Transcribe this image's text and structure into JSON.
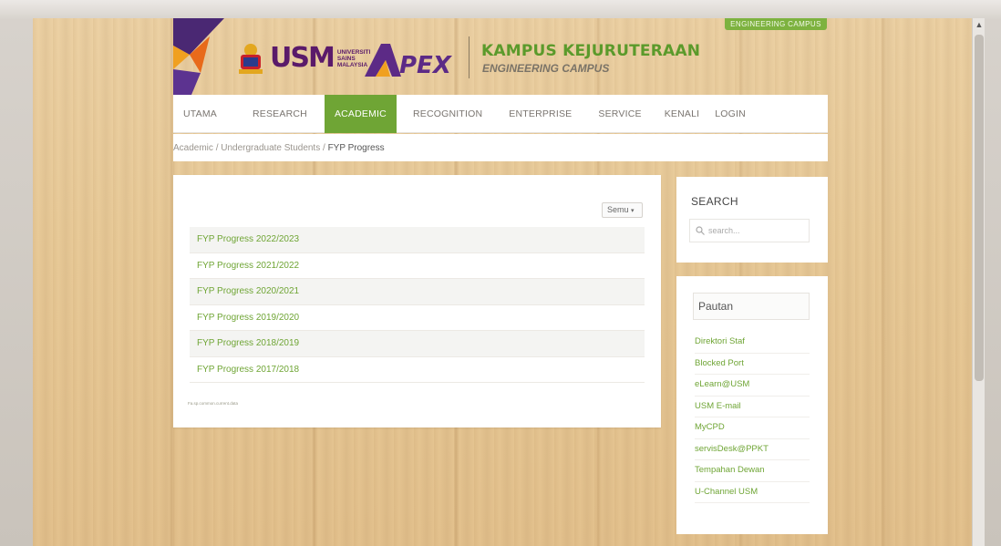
{
  "header": {
    "campus_badge": "ENGINEERING CAMPUS",
    "usm_mark": "USM",
    "usm_small": "UNIVERSITI SAINS MALAYSIA",
    "apex_mark": "APEX",
    "campus_title": "KAMPUS KEJURUTERAAN",
    "campus_subtitle": "ENGINEERING CAMPUS"
  },
  "nav": {
    "items": [
      {
        "label": "UTAMA"
      },
      {
        "label": "RESEARCH"
      },
      {
        "label": "ACADEMIC",
        "active": true
      },
      {
        "label": "RECOGNITION"
      },
      {
        "label": "ENTERPRISE"
      },
      {
        "label": "SERVICE"
      },
      {
        "label": "KENALI"
      },
      {
        "label": "LOGIN"
      }
    ]
  },
  "breadcrumb": {
    "items": [
      "Academic",
      "Undergraduate Students",
      "FYP Progress"
    ],
    "separator": "/"
  },
  "main": {
    "filter_value": "Semu",
    "list": [
      "FYP Progress 2022/2023",
      "FYP Progress 2021/2022",
      "FYP Progress 2020/2021",
      "FYP Progress 2019/2020",
      "FYP Progress 2018/2019",
      "FYP Progress 2017/2018"
    ],
    "footnote": "Fa.sp.common.current.data"
  },
  "sidebar": {
    "search_title": "SEARCH",
    "search_placeholder": "search...",
    "links_title": "Pautan",
    "links": [
      "Direktori Staf",
      "Blocked Port",
      "eLearn@USM",
      "USM E-mail",
      "MyCPD",
      "servisDesk@PPKT",
      "Tempahan Dewan",
      "U-Channel USM"
    ]
  },
  "colors": {
    "accent_green": "#6fa535",
    "brand_purple": "#5a1a6a",
    "brand_orange": "#f0a020"
  }
}
